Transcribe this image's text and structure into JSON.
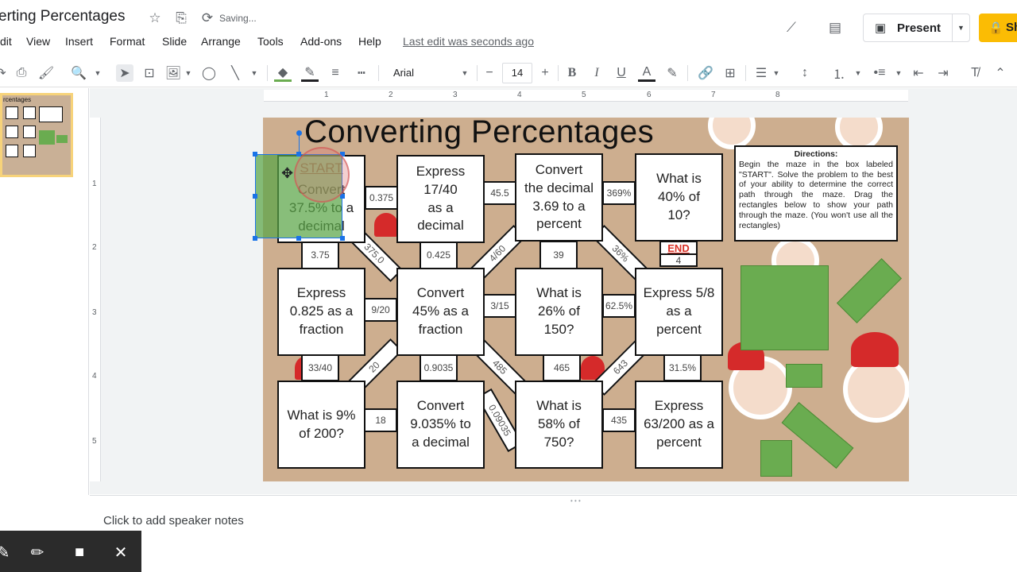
{
  "doc": {
    "title": "erting Percentages",
    "saving": "Saving..."
  },
  "menu": [
    "dit",
    "View",
    "Insert",
    "Format",
    "Slide",
    "Arrange",
    "Tools",
    "Add-ons",
    "Help"
  ],
  "last_edit": "Last edit was seconds ago",
  "present_label": "Present",
  "share_label": "Sh",
  "toolbar": {
    "font": "Arial",
    "size": "14"
  },
  "hruler_nums": [
    "1",
    "2",
    "3",
    "4",
    "5",
    "6",
    "7",
    "8"
  ],
  "vruler_nums": [
    "1",
    "2",
    "3",
    "4",
    "5"
  ],
  "slide": {
    "title": "Converting Percentages",
    "boxes": [
      {
        "id": "start",
        "start": "START",
        "text": "Convert\n37.5% to a\ndecimal"
      },
      {
        "id": "b2",
        "text": "Express 17/40\nas a\ndecimal"
      },
      {
        "id": "b3",
        "text": "Convert\nthe decimal\n3.69 to a\npercent"
      },
      {
        "id": "b4",
        "text": "What is\n40% of\n10?"
      },
      {
        "id": "b5",
        "text": "Express\n0.825 as a\nfraction"
      },
      {
        "id": "b6",
        "text": "Convert\n45% as a\nfraction"
      },
      {
        "id": "b7",
        "text": "What is\n26% of\n150?"
      },
      {
        "id": "b8",
        "text": "Express 5/8\nas a\npercent"
      },
      {
        "id": "b9",
        "text": "What is 9%\nof 200?"
      },
      {
        "id": "b10",
        "text": "Convert\n9.035% to\na decimal"
      },
      {
        "id": "b11",
        "text": "What is\n58% of\n750?"
      },
      {
        "id": "b12",
        "text": "Express\n63/200 as a\npercent"
      }
    ],
    "connectors": [
      "0.375",
      "45.5",
      "369%",
      "3.75",
      "0.425",
      "39",
      "END",
      "4",
      "9/20",
      "3/15",
      "62.5%",
      "33/40",
      "0.9035",
      "465",
      "31.5%",
      "18",
      "435"
    ],
    "diagonals": [
      "375.0",
      "4/60",
      "36%",
      "20",
      "485",
      "643",
      "0.09035"
    ],
    "directions": {
      "heading": "Directions:",
      "body": "Begin the maze in the box labeled \"START\". Solve the problem to the best of your ability to determine the correct path through the maze. Drag the rectangles below to show your path through the maze. (You won't use all the rectangles)"
    }
  },
  "notes_placeholder": "Click to add speaker notes",
  "thumb_title": "rcentages"
}
